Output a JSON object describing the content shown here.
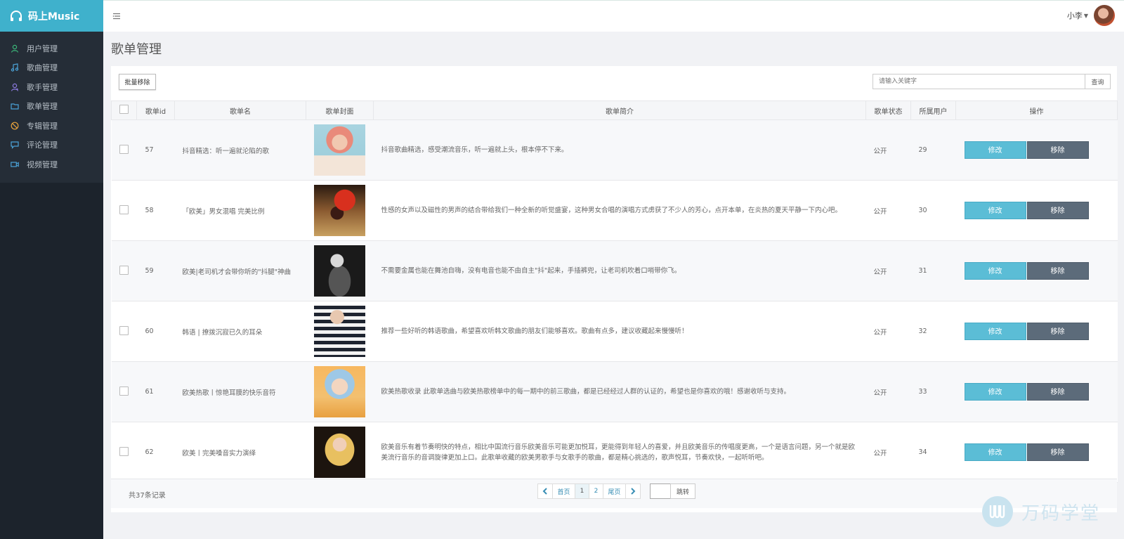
{
  "app": {
    "logo_text": "码上Music"
  },
  "sidebar": {
    "items": [
      {
        "label": "用户管理",
        "icon": "user-icon",
        "color": "#3cb97a"
      },
      {
        "label": "歌曲管理",
        "icon": "music-note-icon",
        "color": "#4ba3d8"
      },
      {
        "label": "歌手管理",
        "icon": "singer-icon",
        "color": "#8c7ae0"
      },
      {
        "label": "歌单管理",
        "icon": "folder-icon",
        "color": "#4ba3d8"
      },
      {
        "label": "专辑管理",
        "icon": "album-icon",
        "color": "#e8a33c"
      },
      {
        "label": "评论管理",
        "icon": "comment-icon",
        "color": "#4ba3d8"
      },
      {
        "label": "视频管理",
        "icon": "video-icon",
        "color": "#4ba3d8"
      }
    ]
  },
  "header": {
    "user_name": "小李"
  },
  "page": {
    "title": "歌单管理"
  },
  "toolbar": {
    "batch_remove_label": "批量移除",
    "search_placeholder": "请输入关键字",
    "search_button_label": "查询"
  },
  "table": {
    "columns": [
      "歌单id",
      "歌单名",
      "歌单封面",
      "歌单简介",
      "歌单状态",
      "所属用户",
      "操作"
    ],
    "edit_label": "修改",
    "remove_label": "移除",
    "rows": [
      {
        "id": "57",
        "name": "抖音精选：听一遍就沦陷的歌",
        "intro": "抖音歌曲精选，感受潮流音乐，听一遍就上头，根本停不下来。",
        "status": "公开",
        "user": "29"
      },
      {
        "id": "58",
        "name": "「欧美」男女混唱 完美比例",
        "intro": "性感的女声以及磁性的男声的结合带给我们一种全新的听觉盛宴，这种男女合唱的演唱方式虏获了不少人的芳心，点开本单，在炎热的夏天平静一下内心吧。",
        "status": "公开",
        "user": "30"
      },
      {
        "id": "59",
        "name": "欧美|老司机才会带你听的\"抖腿\"神曲",
        "intro": "不需要金属也能在舞池自嗨，没有电音也能不由自主\"抖\"起来，手插裤兜，让老司机吹着口哨带你飞。",
        "status": "公开",
        "user": "31"
      },
      {
        "id": "60",
        "name": "韩语 | 撩拨沉寂已久的耳朵",
        "intro": "推荐一些好听的韩语歌曲，希望喜欢听韩文歌曲的朋友们能够喜欢。歌曲有点多，建议收藏起来慢慢听！",
        "status": "公开",
        "user": "32"
      },
      {
        "id": "61",
        "name": "欧美热歌丨惊艳耳膜的快乐音符",
        "intro": "欧美热歌收录 此歌单选曲与欧美热歌榜单中的每一期中的前三歌曲，都是已经经过人群的认证的，希望也是你喜欢的哦！感谢收听与支持。",
        "status": "公开",
        "user": "33"
      },
      {
        "id": "62",
        "name": "欧美丨完美嗓音实力演绎",
        "intro": "欧美音乐有着节奏明快的特点，相比中国流行音乐欧美音乐可能更加悦耳，更能得到年轻人的喜爱，并且欧美音乐的传唱度更高，一个是语言问题，另一个就是欧美流行音乐的音调旋律更加上口。此歌单收藏的欧美男歌手与女歌手的歌曲，都是精心挑选的，歌声悦耳，节奏欢快，一起听听吧。",
        "status": "公开",
        "user": "34"
      }
    ]
  },
  "footer": {
    "total_text": "共37条记录",
    "first_label": "首页",
    "pages": [
      "1",
      "2"
    ],
    "last_label": "尾页",
    "jump_label": "跳转"
  },
  "watermark": {
    "text": "万码学堂"
  },
  "colors": {
    "brand": "#3fb1cc",
    "sidebar_bg": "#1c232c",
    "edit_button": "#5bbdd6",
    "remove_button": "#5c6b7a"
  }
}
